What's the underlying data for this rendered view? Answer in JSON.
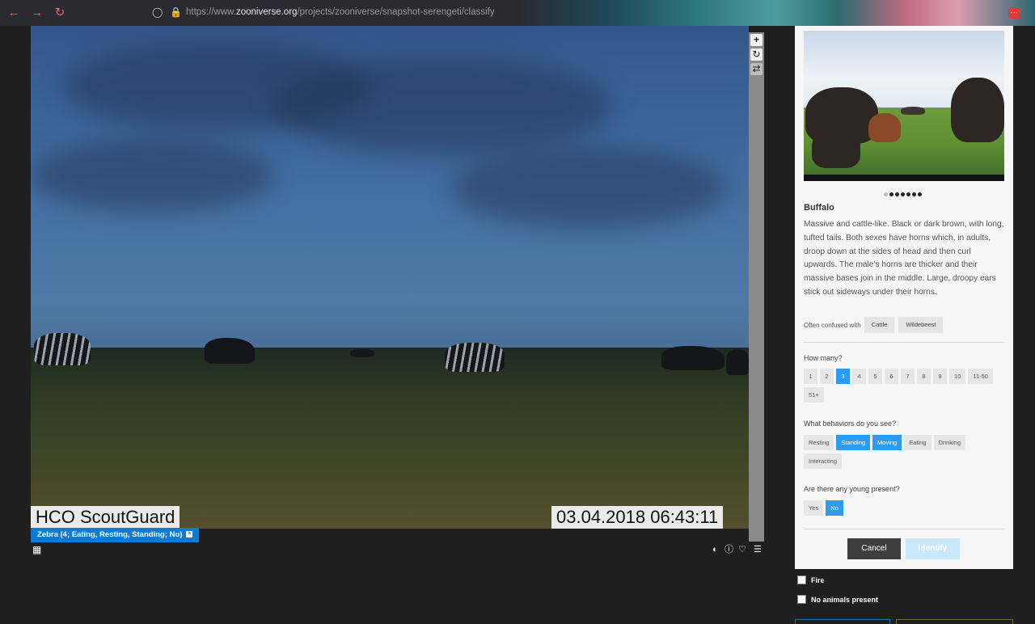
{
  "browser": {
    "url_prefix": "https://www.",
    "url_domain": "zooniverse.org",
    "url_path": "/projects/zooniverse/snapshot-serengeti/classify",
    "back_icon": "arrow-left-icon",
    "forward_icon": "arrow-right-icon",
    "reload_icon": "reload-icon"
  },
  "subject": {
    "camera_label": "HCO ScoutGuard",
    "timestamp": "03.04.2018 06:43:11"
  },
  "annotation_chip": {
    "label": "Zebra (4; Eating, Resting, Standing; No)",
    "remove": "×"
  },
  "tools": [
    "zoom-in-icon",
    "rotate-icon",
    "reset-icon"
  ],
  "bottom_icons": [
    "contrast-icon",
    "info-icon",
    "favorite-icon",
    "collections-icon"
  ],
  "species": {
    "name": "Buffalo",
    "description": "Massive and cattle-like. Black or dark brown, with long, tufted tails. Both sexes have horns which, in adults, droop down at the sides of head and then curl upwards. The male's horns are thicker and their massive bases join in the middle. Large, droopy ears stick out sideways under their horns.",
    "confused_label": "Often confused with",
    "confused_with": [
      "Cattle",
      "Wildebeest"
    ],
    "image_count": 7,
    "active_image": 1
  },
  "how_many": {
    "question": "How many?",
    "options": [
      "1",
      "2",
      "3",
      "4",
      "5",
      "6",
      "7",
      "8",
      "9",
      "10",
      "11-50",
      "51+"
    ],
    "selected": "3"
  },
  "behaviors": {
    "question": "What behaviors do you see?",
    "options": [
      "Resting",
      "Standing",
      "Moving",
      "Eating",
      "Drinking",
      "Interacting"
    ],
    "selected": [
      "Standing",
      "Moving"
    ]
  },
  "young": {
    "question": "Are there any young present?",
    "options": [
      "Yes",
      "No"
    ],
    "selected": "No"
  },
  "actions": {
    "cancel": "Cancel",
    "identify": "Identify"
  },
  "checkboxes": {
    "fire": "Fire",
    "no_animals": "No animals present"
  }
}
